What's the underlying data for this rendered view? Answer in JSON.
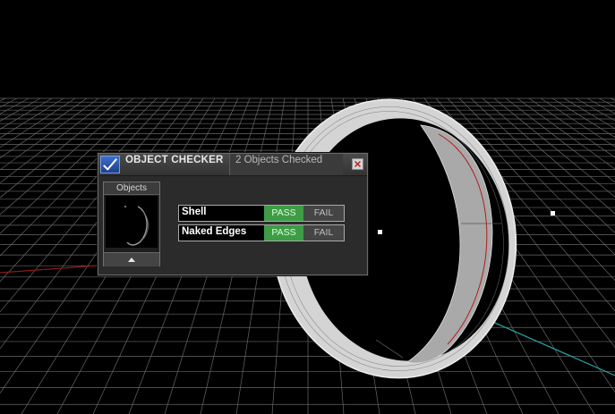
{
  "window": {
    "title": "OBJECT CHECKER",
    "status": "2 Objects Checked"
  },
  "objects_panel": {
    "label": "Objects"
  },
  "checks": [
    {
      "label": "Shell",
      "pass_label": "PASS",
      "fail_label": "FAIL",
      "result": "pass"
    },
    {
      "label": "Naked Edges",
      "pass_label": "PASS",
      "fail_label": "FAIL",
      "result": "pass"
    }
  ],
  "icons": {
    "logo": "checkmark-logo-icon",
    "close": "close-icon",
    "scroll": "triangle-up-icon"
  },
  "colors": {
    "pass": "#3f9c46",
    "fail": "#454545",
    "background": "#000000",
    "grid": "#ffffff",
    "x_axis": "#8b1a1a",
    "y_axis": "#2aa6a6"
  }
}
